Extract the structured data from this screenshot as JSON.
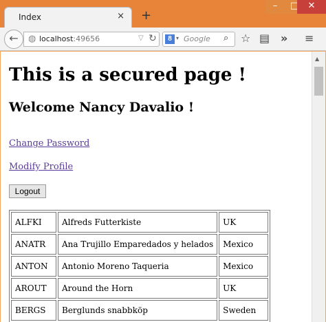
{
  "browser": {
    "tab_title": "Index",
    "tab_close": "×",
    "new_tab": "+",
    "url_host": "localhost",
    "url_port": ":49656",
    "search_placeholder": "Google",
    "window_controls": {
      "minimize": "–",
      "maximize": "□",
      "close": "✕"
    },
    "icons": [
      "back-icon",
      "globe-icon",
      "reload-icon",
      "google-icon",
      "search-icon",
      "star-icon",
      "clipboard-icon",
      "overflow-icon",
      "menu-icon"
    ]
  },
  "page": {
    "heading": "This is a secured page !",
    "welcome": "Welcome Nancy Davalio !",
    "change_password": "Change Password",
    "modify_profile": "Modify Profile",
    "logout": "Logout"
  },
  "customers": {
    "rows": [
      [
        "ALFKI",
        "Alfreds Futterkiste",
        "UK"
      ],
      [
        "ANATR",
        "Ana Trujillo Emparedados y helados",
        "Mexico"
      ],
      [
        "ANTON",
        "Antonio Moreno Taqueria",
        "Mexico"
      ],
      [
        "AROUT",
        "Around the Horn",
        "UK"
      ],
      [
        "BERGS",
        "Berglunds snabbköp",
        "Sweden"
      ]
    ]
  },
  "colors": {
    "titlebar": "#e8843a",
    "link": "#5a3a9a",
    "close_button": "#c8403a"
  }
}
